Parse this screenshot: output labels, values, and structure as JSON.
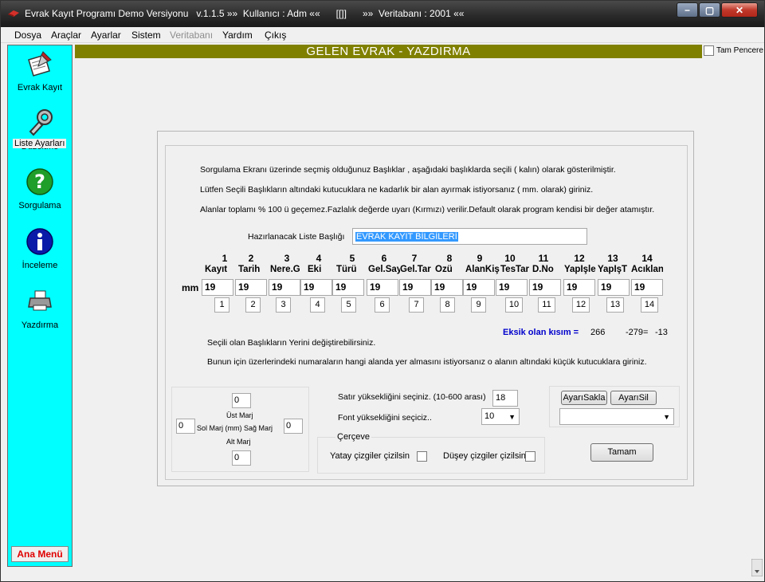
{
  "window": {
    "title": "Evrak Kayıt Programı Demo Versiyonu   v.1.1.5 »»  Kullanıcı : Adm ««      ",
    "title_mid_glyph": "[[]]",
    "title_tail": "»»  Veritabanı : 2001 ««",
    "min_label": "−",
    "max_label": "▢",
    "close_label": "✕"
  },
  "menu": [
    "Dosya",
    "Araçlar",
    "Ayarlar",
    "Sistem",
    "Veritabanı",
    "Yardım",
    "Çıkış"
  ],
  "sidebar": {
    "items": [
      {
        "label": "Evrak Kayıt",
        "icon": "document-edit-icon"
      },
      {
        "label": "Düzeltme",
        "icon": "wrench-icon"
      },
      {
        "label": "Sorgulama",
        "icon": "question-icon"
      },
      {
        "label": "İnceleme",
        "icon": "info-icon"
      },
      {
        "label": "Yazdırma",
        "icon": "printer-icon"
      }
    ],
    "main_menu": "Ana Menü"
  },
  "header": {
    "title": "GELEN EVRAK - YAZDIRMA",
    "fullscreen_label": "Tam Pencere"
  },
  "settings": {
    "group_title": "Liste Ayarları",
    "info1": "Sorgulama Ekranı üzerinde seçmiş olduğunuz  Başlıklar , aşağıdaki başlıklarda seçili ( kalın) olarak  gösterilmiştir.",
    "info2": "Lütfen  Seçili Başlıkların altındaki kutucuklara  ne kadarlık bir alan  ayırmak istiyorsanız ( mm. olarak) giriniz.",
    "info3": "Alanlar toplamı % 100 ü geçemez.Fazlalık değerde uyarı (Kırmızı) verilir.Default olarak program kendisi bir değer atamıştır.",
    "list_title_label": "Hazırlanacak Liste Başlığı",
    "list_title_value": "EVRAK KAYIT BİLGİLERİ",
    "mm_label": "mm",
    "columns": [
      {
        "num": "1",
        "name": "Kayıt",
        "mm": "19",
        "order": "1"
      },
      {
        "num": "2",
        "name": "Tarih",
        "mm": "19",
        "order": "2"
      },
      {
        "num": "3",
        "name": "Nere.G",
        "mm": "19",
        "order": "3"
      },
      {
        "num": "4",
        "name": "Eki",
        "mm": "19",
        "order": "4"
      },
      {
        "num": "5",
        "name": "Türü",
        "mm": "19",
        "order": "5"
      },
      {
        "num": "6",
        "name": "Gel.Say",
        "mm": "19",
        "order": "6"
      },
      {
        "num": "7",
        "name": "Gel.Tar",
        "mm": "19",
        "order": "7"
      },
      {
        "num": "8",
        "name": "Özü",
        "mm": "19",
        "order": "8"
      },
      {
        "num": "9",
        "name": "AlanKiş",
        "mm": "19",
        "order": "9"
      },
      {
        "num": "10",
        "name": "TesTar",
        "mm": "19",
        "order": "10"
      },
      {
        "num": "11",
        "name": "D.No",
        "mm": "19",
        "order": "11"
      },
      {
        "num": "12",
        "name": "Yapİşle",
        "mm": "19",
        "order": "12"
      },
      {
        "num": "13",
        "name": "YapİşT",
        "mm": "19",
        "order": "13"
      },
      {
        "num": "14",
        "name": "Acıklan",
        "mm": "19",
        "order": "14"
      }
    ],
    "missing_label": "Eksik olan kısım =",
    "missing_values": [
      "266",
      "-279=",
      "-13"
    ],
    "reorder1": "Seçili olan Başlıkların Yerini değiştirebilirsiniz.",
    "reorder2": "Bunun için üzerlerindeki numaraların  hangi alanda yer almasını istiyorsanız  o alanın altındaki küçük kutucuklara giriniz.",
    "margins": {
      "top_value": "0",
      "top_label": "Üst Marj",
      "left_value": "0",
      "left_label": "Sol Marj",
      "unit_label": "(mm)",
      "right_label": "Sağ Marj",
      "right_value": "0",
      "bottom_label": "Alt Marj",
      "bottom_value": "0"
    },
    "row_height_label": "Satır yüksekliğini seçiniz.  (10-600 arası)",
    "row_height_value": "18",
    "font_height_label": "Font yüksekliğini seçiciz..",
    "font_height_value": "10",
    "frame_title": "Çerçeve",
    "horizontal_lines_label": "Yatay çizgiler çizilsin",
    "vertical_lines_label": "Düşey çizgiler çizilsin",
    "save_button": "AyarıSakla",
    "delete_button": "AyarıSil",
    "preset_value": "",
    "ok_button": "Tamam"
  },
  "colors": {
    "sidebar": "#00ffff",
    "header": "#808000",
    "missing": "#0000cc",
    "main_menu_text": "#e00000"
  }
}
